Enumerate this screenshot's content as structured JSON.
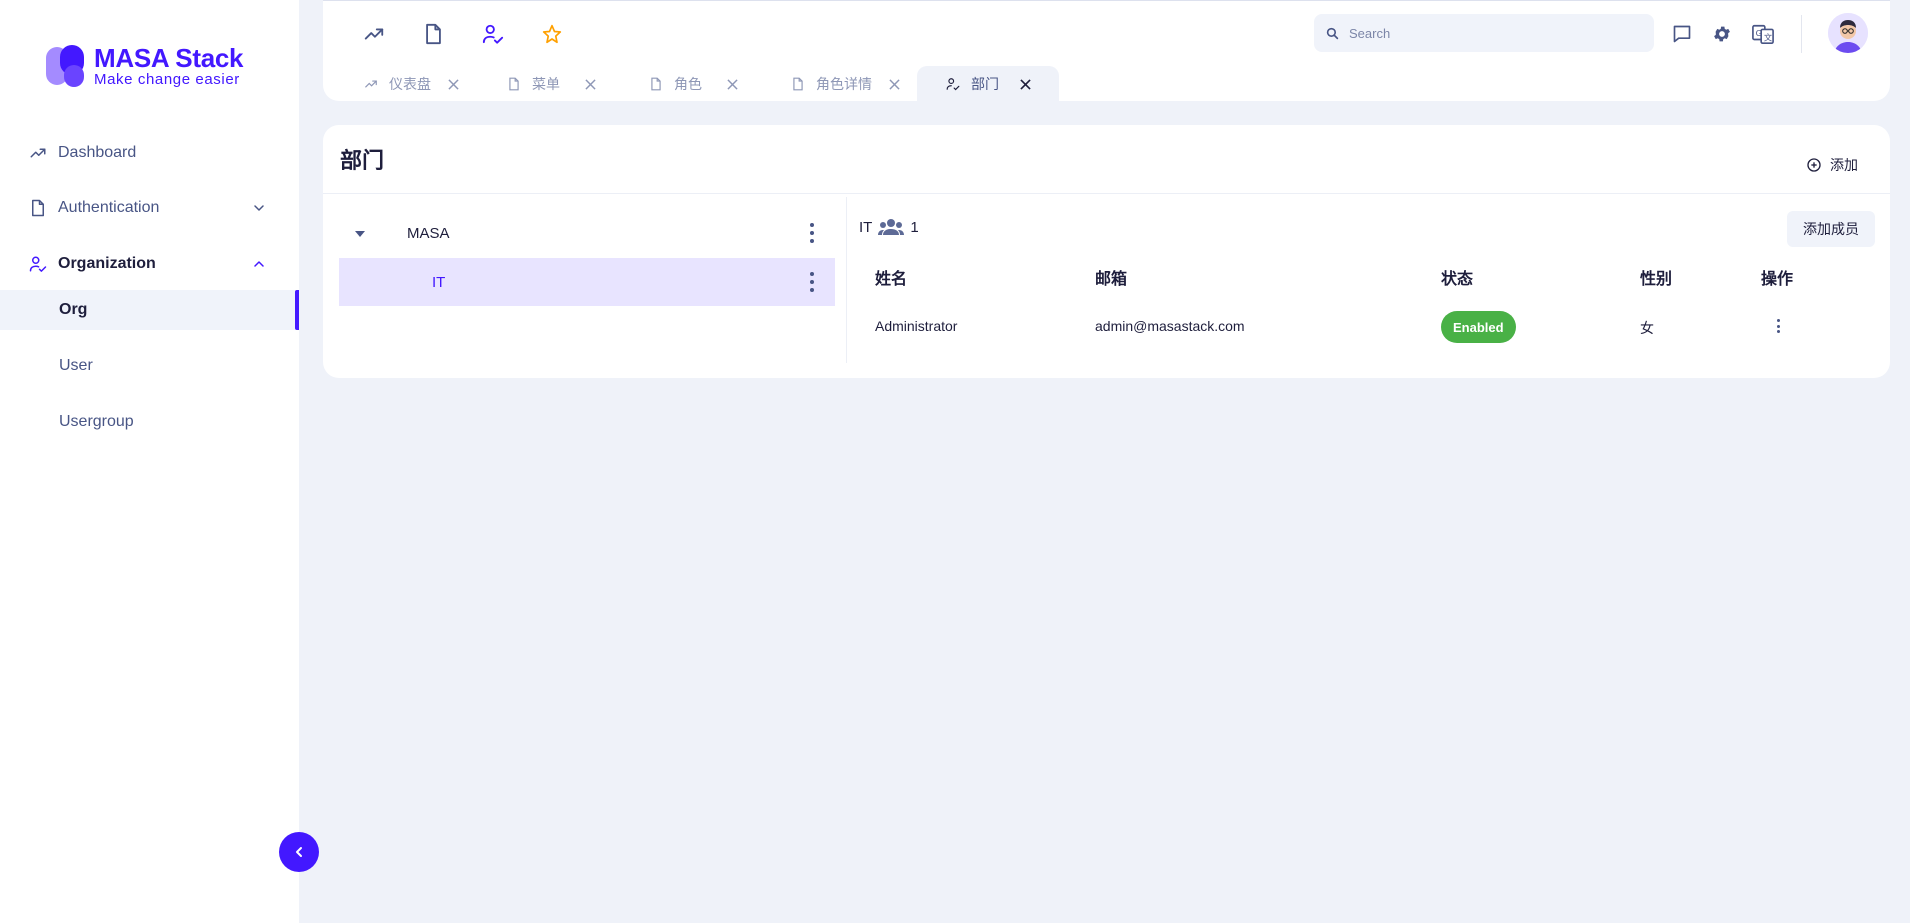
{
  "brand": {
    "title": "MASA Stack",
    "subtitle": "Make change easier",
    "accent": "#4318ff"
  },
  "sidebar": {
    "items": [
      {
        "label": "Dashboard",
        "icon": "trending-up-icon"
      },
      {
        "label": "Authentication",
        "icon": "file-icon",
        "expanded": false
      },
      {
        "label": "Organization",
        "icon": "user-check-icon",
        "expanded": true
      }
    ],
    "subitems": [
      {
        "label": "Org",
        "active": true
      },
      {
        "label": "User",
        "active": false
      },
      {
        "label": "Usergroup",
        "active": false
      }
    ]
  },
  "header": {
    "quick_icons": [
      "trending-up-icon",
      "file-icon",
      "user-check-icon",
      "star-icon"
    ],
    "search": {
      "placeholder": "Search",
      "value": ""
    },
    "right_icons": [
      "message-icon",
      "gear-icon",
      "translate-icon"
    ],
    "tabs": [
      {
        "label": "仪表盘",
        "icon": "trending-up-icon",
        "active": false
      },
      {
        "label": "菜单",
        "icon": "file-icon",
        "active": false
      },
      {
        "label": "角色",
        "icon": "file-icon",
        "active": false
      },
      {
        "label": "角色详情",
        "icon": "file-icon",
        "active": false
      },
      {
        "label": "部门",
        "icon": "user-check-icon",
        "active": true
      }
    ]
  },
  "page": {
    "title": "部门",
    "add_label": "添加"
  },
  "tree": [
    {
      "label": "MASA",
      "expanded": true,
      "selected": false
    },
    {
      "label": "IT",
      "selected": true
    }
  ],
  "department": {
    "name": "IT",
    "member_count": "1",
    "add_member_label": "添加成员"
  },
  "table": {
    "columns": [
      "姓名",
      "邮箱",
      "状态",
      "性别",
      "操作"
    ],
    "rows": [
      {
        "name": "Administrator",
        "email": "admin@masastack.com",
        "status": "Enabled",
        "gender": "女"
      }
    ]
  },
  "colors": {
    "status_enabled": "#49b146",
    "selection_bg": "#e8e4ff",
    "background": "#eff2f9"
  }
}
